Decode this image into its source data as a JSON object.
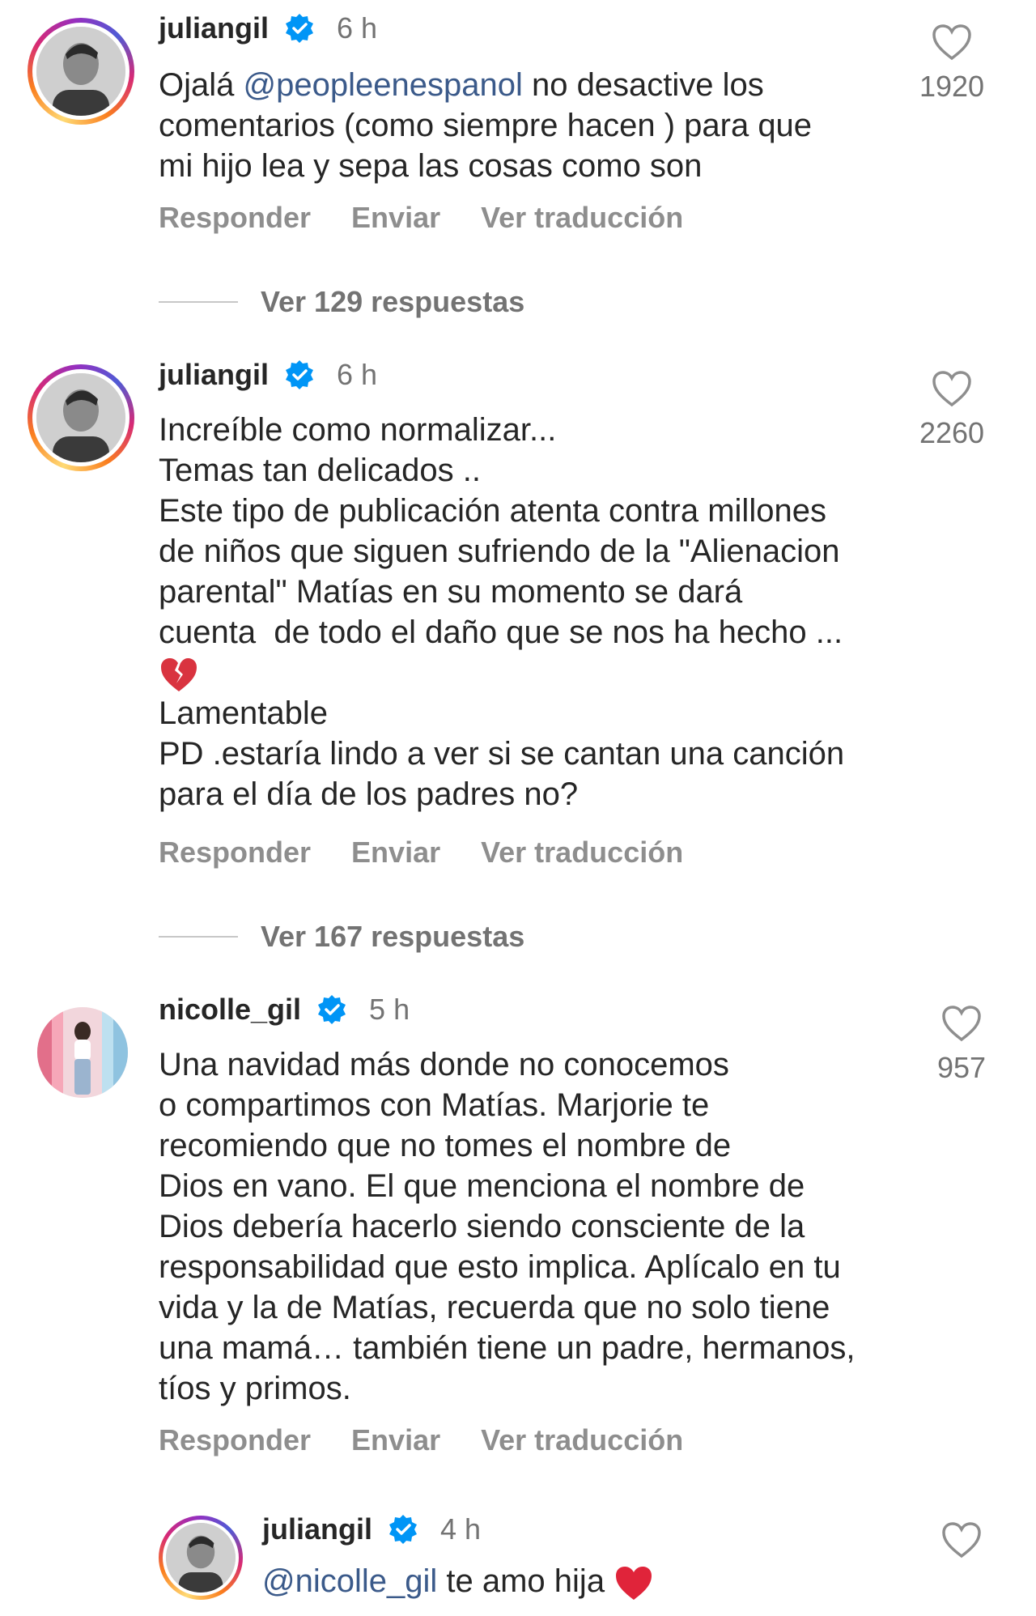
{
  "comments": [
    {
      "username": "juliangil",
      "time": "6 h",
      "text_before": "Ojalá ",
      "mention": "@peopleenespanol",
      "text_after": " no desactive los\ncomentarios (como siempre hacen ) para que\nmi hijo lea y sepa las cosas como son",
      "likes": "1920",
      "actions": [
        "Responder",
        "Enviar",
        "Ver traducción"
      ],
      "replies_label": "Ver 129 respuestas"
    },
    {
      "username": "juliangil",
      "time": "6 h",
      "text_1": "Increíble como normalizar...\nTemas tan delicados ..\nEste tipo de publicación atenta contra millones\nde niños que siguen sufriendo de la \"Alienacion\nparental\" Matías en su momento se dará\ncuenta  de todo el daño que se nos ha hecho ...",
      "text_2": "Lamentable\nPD .estaría lindo a ver si se cantan una canción\npara el día de los padres no?",
      "likes": "2260",
      "actions": [
        "Responder",
        "Enviar",
        "Ver traducción"
      ],
      "replies_label": "Ver 167 respuestas"
    },
    {
      "username": "nicolle_gil",
      "time": "5 h",
      "text": "Una navidad más donde no conocemos\no compartimos con Matías. Marjorie te\nrecomiendo que no tomes el nombre de\nDios en vano. El que menciona el nombre de\nDios debería hacerlo siendo consciente de la\nresponsabilidad que esto implica. Aplícalo en tu\nvida y la de Matías, recuerda que no solo tiene\nuna mamá… también tiene un padre, hermanos,\ntíos y primos.",
      "likes": "957",
      "actions": [
        "Responder",
        "Enviar",
        "Ver traducción"
      ]
    },
    {
      "username": "juliangil",
      "time": "4 h",
      "mention": "@nicolle_gil",
      "text_after": " te amo hija"
    }
  ],
  "colors": {
    "text": "#262626",
    "secondary": "#737373",
    "mention": "#3b5a8a",
    "verified": "#0095f6"
  }
}
